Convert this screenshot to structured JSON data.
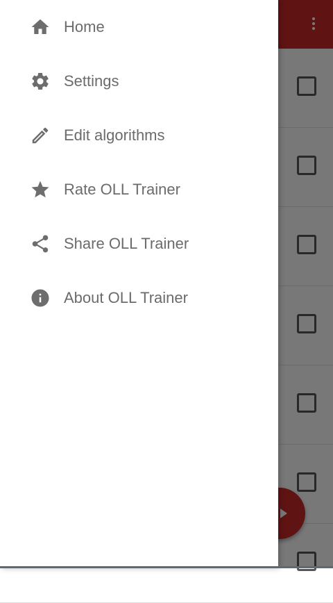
{
  "drawer": {
    "items": [
      {
        "label": "Home",
        "icon": "home-icon"
      },
      {
        "label": "Settings",
        "icon": "gear-icon"
      },
      {
        "label": "Edit algorithms",
        "icon": "pencil-icon"
      },
      {
        "label": "Rate OLL Trainer",
        "icon": "star-icon"
      },
      {
        "label": "Share OLL Trainer",
        "icon": "share-icon"
      },
      {
        "label": "About OLL Trainer",
        "icon": "info-icon"
      }
    ]
  },
  "colors": {
    "toolbar": "#c62828",
    "fab": "#c62828",
    "icon": "#6d6d6d",
    "label": "#6b6b6b"
  },
  "background": {
    "overflow_icon": "more-vert-icon",
    "fab_icon": "play-arrow-icon",
    "checkbox_count": 7
  }
}
